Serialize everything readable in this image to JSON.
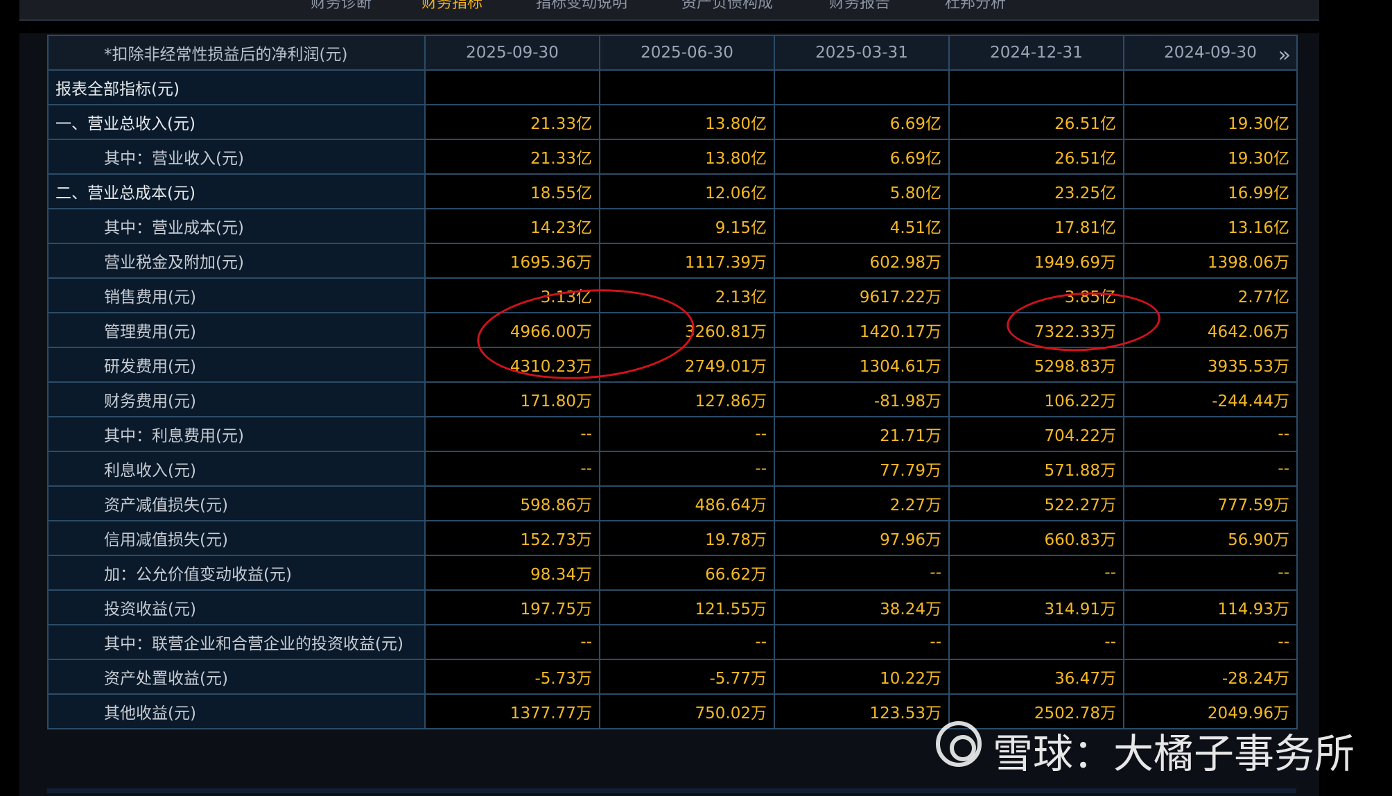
{
  "nav_tabs": [
    "财务诊断",
    "财务指标",
    "指标变动说明",
    "资产负债构成",
    "财务报告",
    "杜邦分析"
  ],
  "active_tab": "财务指标",
  "table": {
    "label_header": "*扣除非经常性损益后的净利润(元)",
    "periods": [
      "2025-09-30",
      "2025-06-30",
      "2025-03-31",
      "2024-12-31",
      "2024-09-30"
    ],
    "next_icon": "chevron-double-right-icon",
    "rows": [
      {
        "label": "报表全部指标(元)",
        "top": true,
        "values": [
          "",
          "",
          "",
          "",
          ""
        ]
      },
      {
        "label": "一、营业总收入(元)",
        "top": true,
        "values": [
          "21.33亿",
          "13.80亿",
          "6.69亿",
          "26.51亿",
          "19.30亿"
        ]
      },
      {
        "label": "其中：营业收入(元)",
        "values": [
          "21.33亿",
          "13.80亿",
          "6.69亿",
          "26.51亿",
          "19.30亿"
        ]
      },
      {
        "label": "二、营业总成本(元)",
        "top": true,
        "values": [
          "18.55亿",
          "12.06亿",
          "5.80亿",
          "23.25亿",
          "16.99亿"
        ]
      },
      {
        "label": "其中：营业成本(元)",
        "values": [
          "14.23亿",
          "9.15亿",
          "4.51亿",
          "17.81亿",
          "13.16亿"
        ]
      },
      {
        "label": "营业税金及附加(元)",
        "values": [
          "1695.36万",
          "1117.39万",
          "602.98万",
          "1949.69万",
          "1398.06万"
        ]
      },
      {
        "label": "销售费用(元)",
        "values": [
          "3.13亿",
          "2.13亿",
          "9617.22万",
          "3.85亿",
          "2.77亿"
        ]
      },
      {
        "label": "管理费用(元)",
        "values": [
          "4966.00万",
          "3260.81万",
          "1420.17万",
          "7322.33万",
          "4642.06万"
        ]
      },
      {
        "label": "研发费用(元)",
        "values": [
          "4310.23万",
          "2749.01万",
          "1304.61万",
          "5298.83万",
          "3935.53万"
        ]
      },
      {
        "label": "财务费用(元)",
        "values": [
          "171.80万",
          "127.86万",
          "-81.98万",
          "106.22万",
          "-244.44万"
        ]
      },
      {
        "label": "其中：利息费用(元)",
        "values": [
          "--",
          "--",
          "21.71万",
          "704.22万",
          "--"
        ]
      },
      {
        "label": "利息收入(元)",
        "values": [
          "--",
          "--",
          "77.79万",
          "571.88万",
          "--"
        ]
      },
      {
        "label": "资产减值损失(元)",
        "values": [
          "598.86万",
          "486.64万",
          "2.27万",
          "522.27万",
          "777.59万"
        ]
      },
      {
        "label": "信用减值损失(元)",
        "values": [
          "152.73万",
          "19.78万",
          "97.96万",
          "660.83万",
          "56.90万"
        ]
      },
      {
        "label": "加：公允价值变动收益(元)",
        "values": [
          "98.34万",
          "66.62万",
          "--",
          "--",
          "--"
        ]
      },
      {
        "label": "投资收益(元)",
        "values": [
          "197.75万",
          "121.55万",
          "38.24万",
          "314.91万",
          "114.93万"
        ]
      },
      {
        "label": "其中：联营企业和合营企业的投资收益(元)",
        "values": [
          "--",
          "--",
          "--",
          "--",
          "--"
        ]
      },
      {
        "label": "资产处置收益(元)",
        "values": [
          "-5.73万",
          "-5.77万",
          "10.22万",
          "36.47万",
          "-28.24万"
        ]
      },
      {
        "label": "其他收益(元)",
        "values": [
          "1377.77万",
          "750.02万",
          "123.53万",
          "2502.78万",
          "2049.96万"
        ]
      }
    ]
  },
  "annotation_color": "#d3121b",
  "watermark": {
    "text": "雪球：大橘子事务所",
    "logo_icon": "xueqiu-logo-icon"
  }
}
